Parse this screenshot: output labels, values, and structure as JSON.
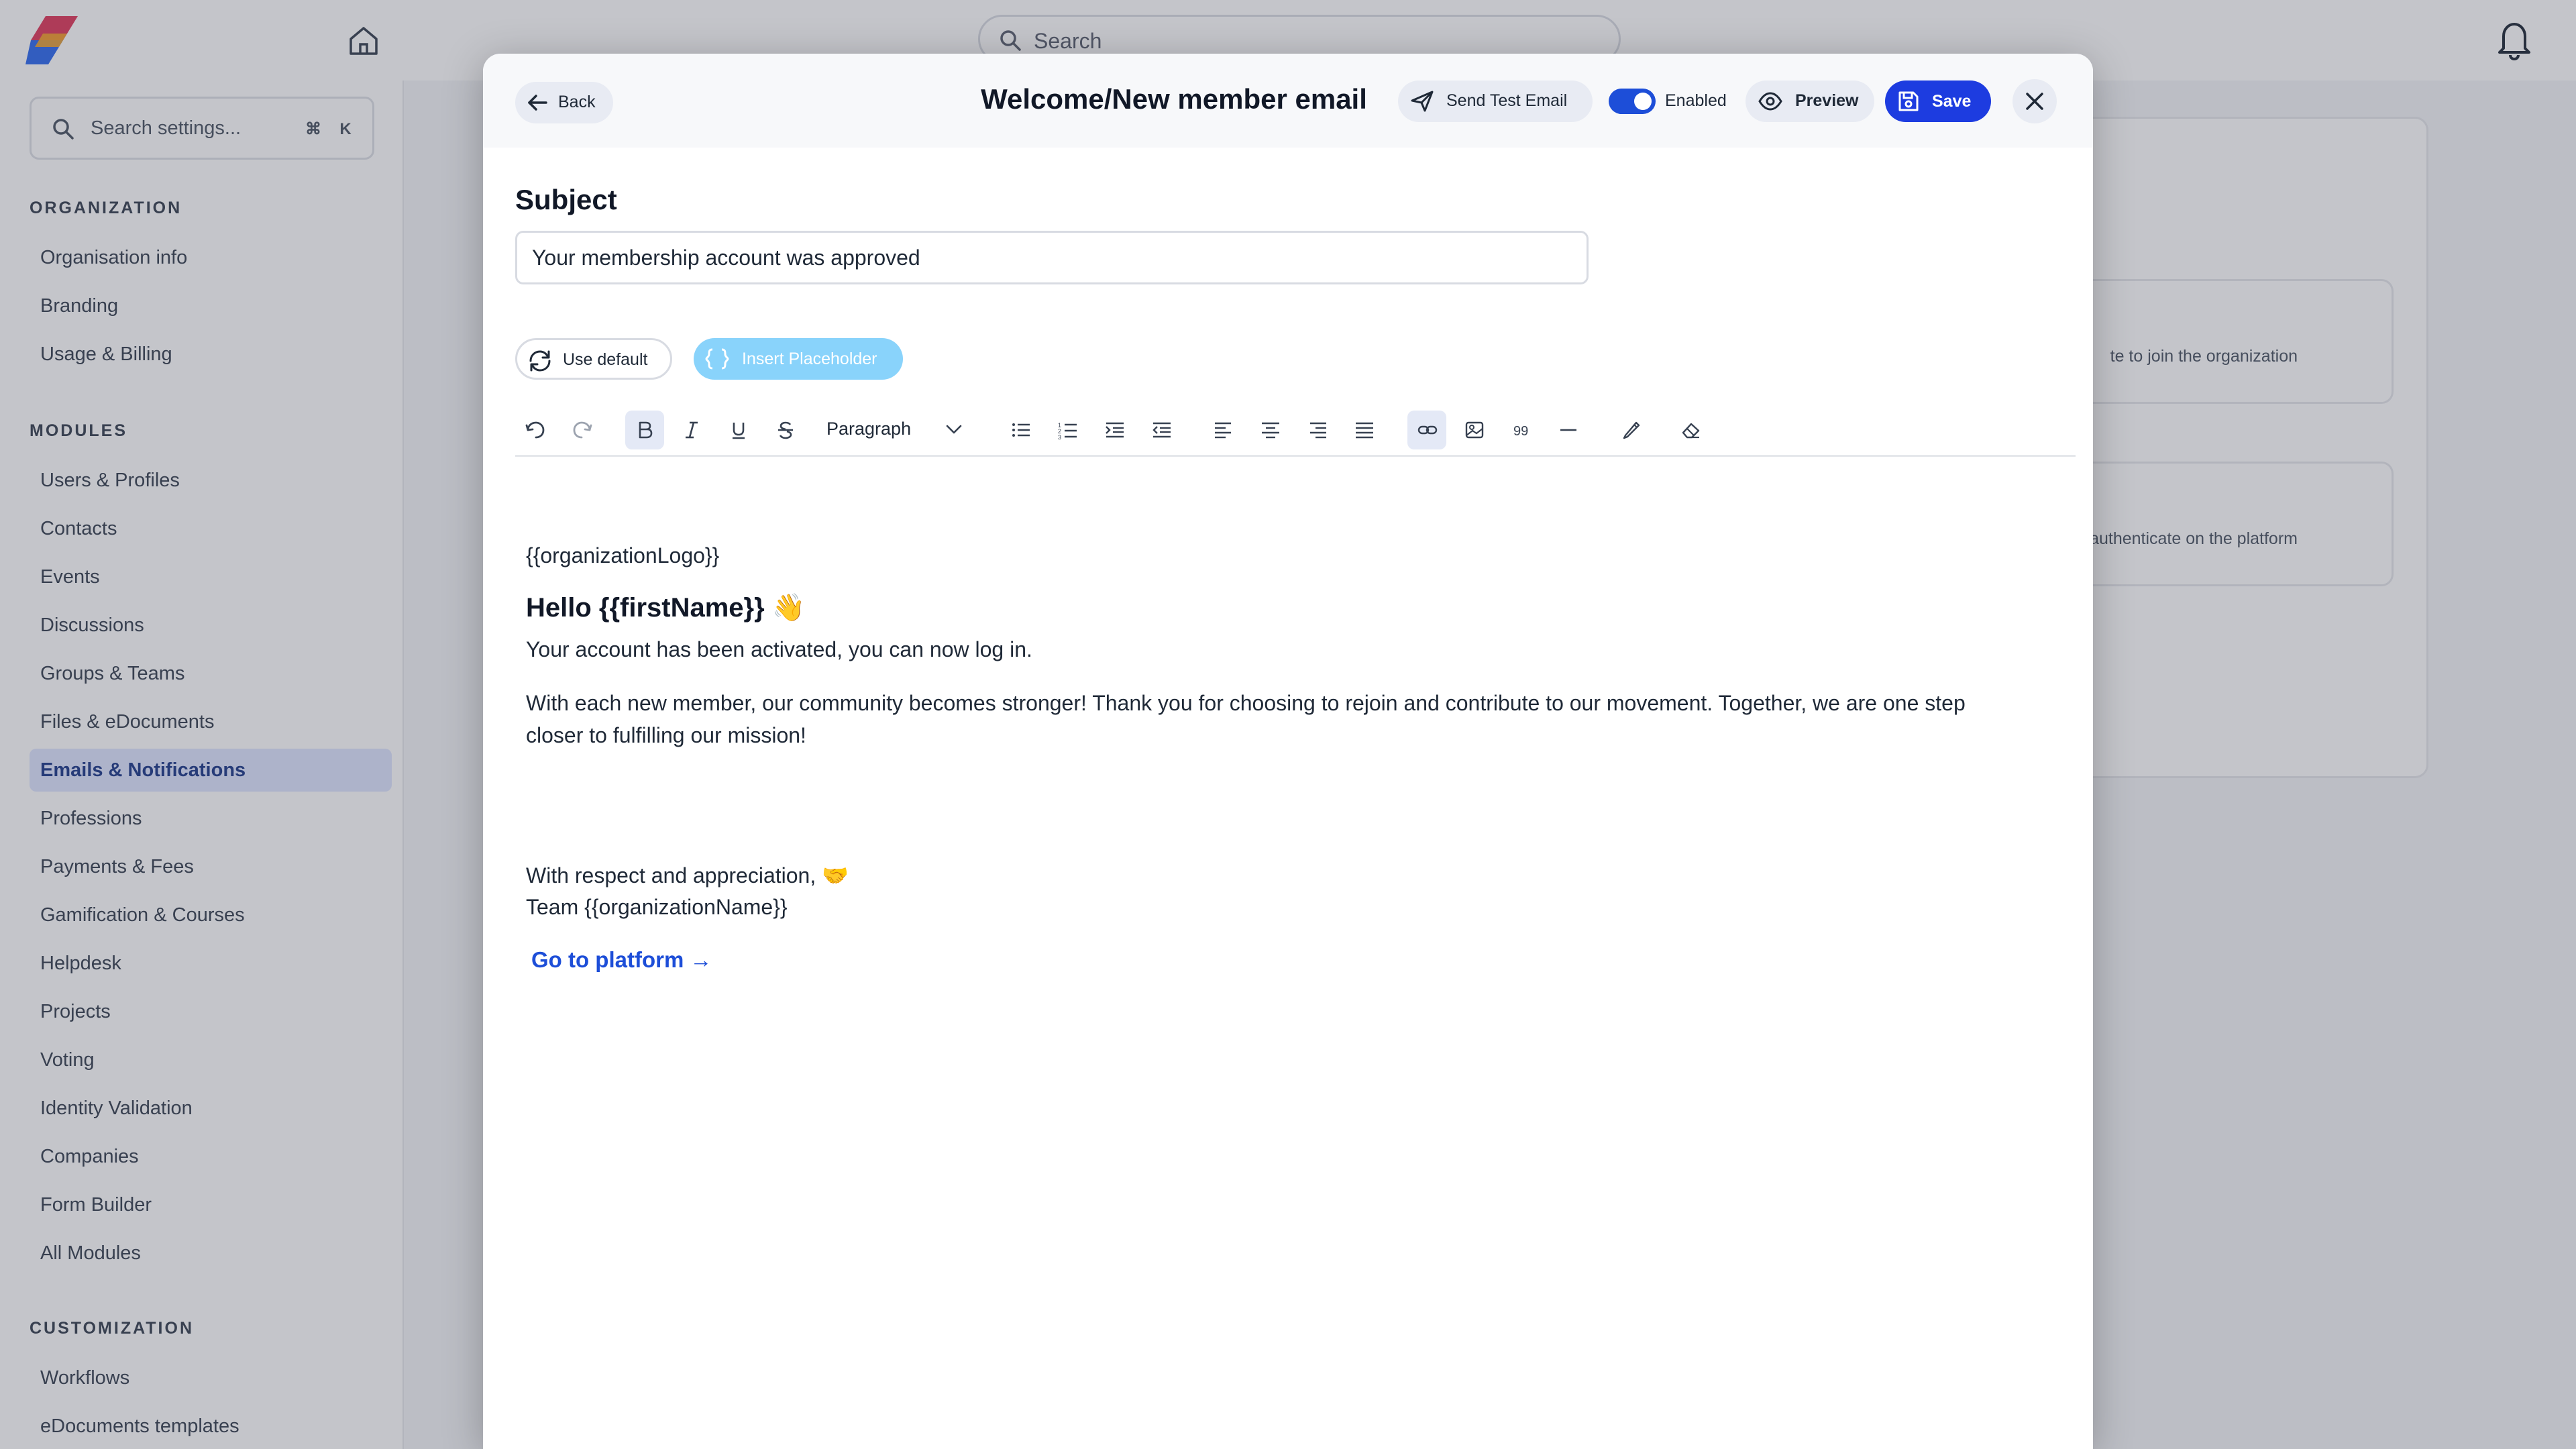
{
  "topbar": {
    "search_placeholder": "Search"
  },
  "sidebar": {
    "search_placeholder": "Search settings...",
    "shortcut_keys": [
      "⌘",
      "K"
    ],
    "sections": {
      "organization": {
        "title": "ORGANIZATION",
        "items": [
          "Organisation info",
          "Branding",
          "Usage & Billing"
        ]
      },
      "modules": {
        "title": "MODULES",
        "items": [
          "Users & Profiles",
          "Contacts",
          "Events",
          "Discussions",
          "Groups & Teams",
          "Files & eDocuments",
          "Emails & Notifications",
          "Professions",
          "Payments & Fees",
          "Gamification & Courses",
          "Helpdesk",
          "Projects",
          "Voting",
          "Identity Validation",
          "Companies",
          "Form Builder",
          "All Modules"
        ],
        "active_item": "Emails & Notifications"
      },
      "customization": {
        "title": "CUSTOMIZATION",
        "items": [
          "Workflows",
          "eDocuments templates"
        ]
      }
    }
  },
  "background": {
    "row1_text": "te to join the organization",
    "row2_text": "authenticate on the platform"
  },
  "modal": {
    "back_label": "Back",
    "title": "Welcome/New member email",
    "send_test_label": "Send Test Email",
    "enabled_label": "Enabled",
    "enabled": true,
    "preview_label": "Preview",
    "save_label": "Save",
    "subject_label": "Subject",
    "subject_value": "Your membership account was approved",
    "use_default_label": "Use default",
    "insert_placeholder_label": "Insert Placeholder",
    "toolbar": {
      "paragraph_label": "Paragraph",
      "quote_glyph": "99"
    },
    "body": {
      "logo_placeholder": "{{organizationLogo}}",
      "greeting": "Hello {{firstName}} 👋",
      "line1": "Your account has been activated, you can now log in.",
      "line2a": "With each new member, our community becomes stronger! Thank you for choosing to rejoin and contribute to our movement. Together, we are one step",
      "line2b": "closer to fulfilling our mission!",
      "closing": "With respect and appreciation, 🤝",
      "signature": "Team {{organizationName}}",
      "cta": "Go to platform →"
    }
  },
  "colors": {
    "accent": "#1d3ce0",
    "toggle_on": "#1d4ed8",
    "insert_placeholder_bg": "#89d3fb",
    "active_nav_bg": "#dfe6ff"
  }
}
